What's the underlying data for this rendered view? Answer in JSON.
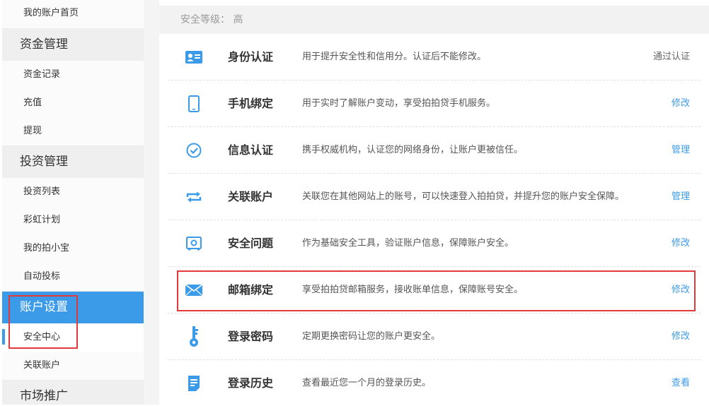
{
  "sidebar": {
    "items": [
      {
        "label": "我的账户首页",
        "type": "item"
      },
      {
        "label": "资金管理",
        "type": "header"
      },
      {
        "label": "资金记录",
        "type": "item"
      },
      {
        "label": "充值",
        "type": "item"
      },
      {
        "label": "提现",
        "type": "item"
      },
      {
        "label": "投资管理",
        "type": "header"
      },
      {
        "label": "投资列表",
        "type": "item"
      },
      {
        "label": "彩虹计划",
        "type": "item"
      },
      {
        "label": "我的拍小宝",
        "type": "item"
      },
      {
        "label": "自动投标",
        "type": "item"
      },
      {
        "label": "账户设置",
        "type": "header",
        "active": true
      },
      {
        "label": "安全中心",
        "type": "item",
        "selected": true
      },
      {
        "label": "关联账户",
        "type": "item"
      },
      {
        "label": "市场推广",
        "type": "header"
      }
    ]
  },
  "main": {
    "security_level": "安全等级： 高",
    "rows": [
      {
        "icon": "id-card-icon",
        "title": "身份认证",
        "desc": "用于提升安全性和信用分。认证后不能修改。",
        "action": "通过认证",
        "action_link": false
      },
      {
        "icon": "phone-icon",
        "title": "手机绑定",
        "desc": "用于实时了解账户变动，享受拍拍贷手机服务。",
        "action": "修改",
        "action_link": true
      },
      {
        "icon": "check-circle-icon",
        "title": "信息认证",
        "desc": "携手权威机构，认证您的网络身份，让账户更被信任。",
        "action": "管理",
        "action_link": true
      },
      {
        "icon": "link-arrows-icon",
        "title": "关联账户",
        "desc": "关联您在其他网站上的账号，可以快速登入拍拍贷，并提升您的账户安全保障。",
        "action": "管理",
        "action_link": true
      },
      {
        "icon": "safe-icon",
        "title": "安全问题",
        "desc": "作为基础安全工具，验证账户信息，保障账户安全。",
        "action": "修改",
        "action_link": true
      },
      {
        "icon": "envelope-icon",
        "title": "邮箱绑定",
        "desc": "享受拍拍贷邮箱服务，接收账单信息，保障账号安全。",
        "action": "修改",
        "action_link": true
      },
      {
        "icon": "key-icon",
        "title": "登录密码",
        "desc": "定期更换密码让您的账户更安全。",
        "action": "修改",
        "action_link": true
      },
      {
        "icon": "document-icon",
        "title": "登录历史",
        "desc": "查看最近您一个月的登录历史。",
        "action": "查看",
        "action_link": true
      }
    ]
  },
  "colors": {
    "accent": "#3c9be8",
    "highlight": "#e23a3a"
  }
}
